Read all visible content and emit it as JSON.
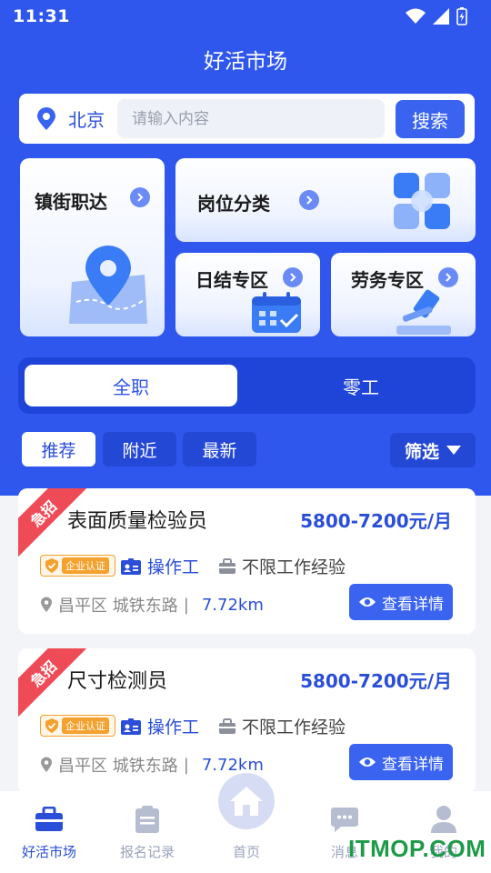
{
  "status_bar": {
    "time": "11:31"
  },
  "header": {
    "title": "好活市场"
  },
  "search": {
    "city": "北京",
    "placeholder": "请输入内容",
    "button_label": "搜索"
  },
  "feature_cards": [
    {
      "label": "镇街职达"
    },
    {
      "label": "岗位分类"
    },
    {
      "label": "日结专区"
    },
    {
      "label": "劳务专区"
    }
  ],
  "job_tabs": [
    {
      "label": "全职",
      "active": true
    },
    {
      "label": "零工",
      "active": false
    }
  ],
  "filter_chips": [
    {
      "label": "推荐",
      "active": true
    },
    {
      "label": "附近",
      "active": false
    },
    {
      "label": "最新",
      "active": false
    }
  ],
  "filter_label": "筛选",
  "jobs": [
    {
      "urgent_label": "急招",
      "title": "表面质量检验员",
      "salary": "5800-7200元/月",
      "verified_label": "企业认证",
      "job_type": "操作工",
      "experience": "不限工作经验",
      "address": "昌平区 城铁东路",
      "separator": "|",
      "distance": "7.72km",
      "detail_label": "查看详情"
    },
    {
      "urgent_label": "急招",
      "title": "尺寸检测员",
      "salary": "5800-7200元/月",
      "verified_label": "企业认证",
      "job_type": "操作工",
      "experience": "不限工作经验",
      "address": "昌平区 城铁东路",
      "separator": "|",
      "distance": "7.72km",
      "detail_label": "查看详情"
    }
  ],
  "bottom_nav": [
    {
      "label": "好活市场",
      "icon": "briefcase-icon",
      "active": true
    },
    {
      "label": "报名记录",
      "icon": "clipboard-icon",
      "active": false
    },
    {
      "label": "首页",
      "icon": "home-icon",
      "active": false
    },
    {
      "label": "消息",
      "icon": "chat-icon",
      "active": false
    },
    {
      "label": "我的",
      "icon": "user-icon",
      "active": false
    }
  ],
  "watermark": "ITMOP.COM",
  "colors": {
    "primary": "#2f57ee",
    "accent": "#2a4ed8",
    "urgent": "#ef4b57",
    "verified": "#f4a12e"
  }
}
